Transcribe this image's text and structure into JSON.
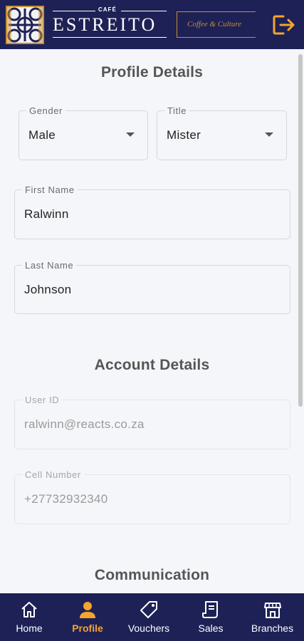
{
  "header": {
    "brand_small": "CAFÉ",
    "brand_name": "ESTREITO",
    "tagline": "Coffee & Culture",
    "logout_icon": "logout-icon"
  },
  "profile": {
    "title": "Profile Details",
    "gender": {
      "label": "Gender",
      "value": "Male"
    },
    "salutation": {
      "label": "Title",
      "value": "Mister"
    },
    "first_name": {
      "label": "First Name",
      "value": "Ralwinn"
    },
    "last_name": {
      "label": "Last Name",
      "value": "Johnson"
    }
  },
  "account": {
    "title": "Account Details",
    "user_id": {
      "label": "User ID",
      "value": "ralwinn@reacts.co.za"
    },
    "cell": {
      "label": "Cell Number",
      "value": "+27732932340"
    }
  },
  "communication": {
    "title": "Communication"
  },
  "nav": {
    "items": [
      {
        "label": "Home",
        "icon": "home-icon",
        "active": false
      },
      {
        "label": "Profile",
        "icon": "person-icon",
        "active": true
      },
      {
        "label": "Vouchers",
        "icon": "tag-icon",
        "active": false
      },
      {
        "label": "Sales",
        "icon": "receipt-icon",
        "active": false
      },
      {
        "label": "Branches",
        "icon": "store-icon",
        "active": false
      }
    ]
  },
  "colors": {
    "header_bg": "#1e2156",
    "accent": "#c8902e",
    "active_nav": "#f4a52c",
    "page_bg": "#f5f6fa"
  }
}
